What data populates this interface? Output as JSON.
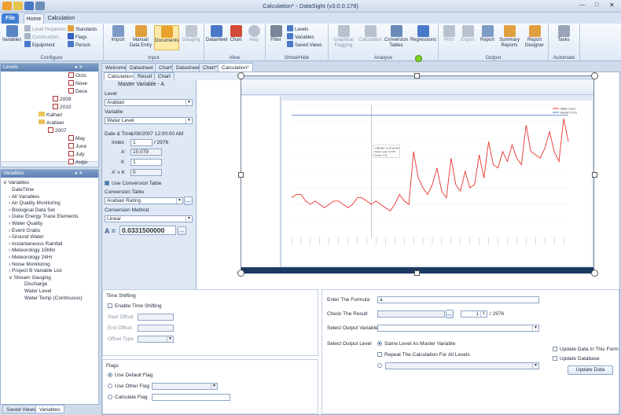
{
  "window": {
    "title": "Calculation* - DataSight (v3.0.0.178)"
  },
  "tabs": {
    "file": "File",
    "home": "Home",
    "calculation": "Calculation"
  },
  "ribbon": {
    "configure": {
      "label": "Configure",
      "variables": "Variables",
      "level_properties": "Level Properties",
      "construction": "Construction",
      "equipment": "Equipment",
      "standards": "Standards",
      "flags": "Flags",
      "person": "Person"
    },
    "input": {
      "label": "Input",
      "import": "Import",
      "manual": "Manual Data Entry",
      "documents": "Documents",
      "gauging": "Gauging"
    },
    "view": {
      "label": "View",
      "datasheet": "Datasheet",
      "chart": "Chart",
      "map": "Map"
    },
    "showhide": {
      "label": "Show/Hide",
      "filter": "Filter",
      "levels": "Levels",
      "variables": "Variables",
      "saved_views": "Saved Views"
    },
    "analyse": {
      "label": "Analyse",
      "graphical": "Graphical Flagging",
      "calculation": "Calculation",
      "conversion": "Conversion Tables",
      "regressions": "Regressions"
    },
    "output": {
      "label": "Output",
      "print": "Print",
      "export": "Export",
      "report": "Report",
      "summary": "Summary Reports",
      "designer": "Report Designer"
    },
    "automate": {
      "label": "Automate",
      "tasks": "Tasks"
    }
  },
  "levels": {
    "title": "Levels",
    "rows": [
      "Octo",
      "Nove",
      "Dece",
      "2009",
      "2010",
      "Kalhari",
      "Arabian",
      "2007",
      "May",
      "June",
      "July",
      "Augu"
    ]
  },
  "variables": {
    "title": "Variables",
    "root": "Variables",
    "items": [
      "DateTime",
      "All Variables",
      "Air Quality Monitoring",
      "Biological Data Set",
      "Duke Energy Trace Elements",
      "Water Quality",
      "Event Grabs",
      "Ground Water",
      "Instantaneous Rainfall",
      "Meteorology 15Min",
      "Meteorology 24Hr",
      "Noise Monitoring",
      "Project B Variable List",
      "Stream Gauging",
      "Discharge",
      "Water Level",
      "Water Temp (Continuous)"
    ]
  },
  "bottom_tabs": {
    "saved_views": "Saved Views",
    "variables": "Variables"
  },
  "doc_tabs": [
    "Welcome",
    "Datasheet",
    "Chart*",
    "Datasheet",
    "Chart*",
    "Calculation*"
  ],
  "sub_tabs": [
    "Calculation",
    "Result",
    "Chart"
  ],
  "master": {
    "title": "Master Variable - A",
    "level_label": "Level",
    "level_value": "Arabian",
    "variable_label": "Variable",
    "variable_value": "Water Level",
    "datetime_label": "Date & Time",
    "datetime_value": "1/08/2007 12:00:00 AM",
    "index_label": "Index",
    "index_value": "1",
    "index_total": "/ 2976",
    "a_label": "A'",
    "a_value": "10.079",
    "k_label": "K",
    "k_value": "1",
    "axk_label": "A' x K",
    "axk_value": "0",
    "use_conversion": "Use Conversion Table",
    "conv_table_label": "Conversion Table",
    "conv_table_value": "Arabian Rating",
    "conv_method_label": "Conversion Method",
    "conv_method_value": "Linear",
    "result_label": "A =",
    "result_value": "0.0331500000"
  },
  "time_shift": {
    "title": "Time Shifting",
    "enable": "Enable Time Shifting",
    "start": "Start Offset",
    "end": "End Offset",
    "type": "Offset Type"
  },
  "flags": {
    "title": "Flags",
    "default": "Use Default Flag",
    "other": "Use Other Flag",
    "calculate": "Calculate Flag"
  },
  "formula": {
    "enter_label": "Enter The Formula",
    "enter_value": "a",
    "check_label": "Check The Result",
    "check_index": "1",
    "check_total": "/ 2976",
    "output_var_label": "Select Output Variable",
    "output_level_label": "Select Output Level",
    "same_level": "Same Level As Master Variable",
    "repeat": "Repeat The Calculation For All Levels",
    "update_form": "Update Data In This Form",
    "update_db": "Update Database",
    "update_btn": "Update Data"
  },
  "embedded": {
    "title": "Calculation* - DataSight",
    "legend": [
      "Water Level",
      "Result X 0.01"
    ],
    "tooltip": [
      "1/08/2007 12:00:00 AM",
      "Water Level: 10.079",
      "Result: 0.03"
    ]
  },
  "chart_data": {
    "type": "line",
    "ylim": [
      8,
      12
    ],
    "series": [
      {
        "name": "Water Level",
        "color": "#e8332c",
        "values": [
          9.2,
          9.3,
          9.3,
          9.1,
          9.0,
          9.1,
          9.0,
          8.9,
          9.0,
          9.1,
          9.1,
          9.0,
          8.9,
          9.0,
          9.2,
          9.2,
          9.1,
          9.0,
          9.1,
          9.0,
          8.9,
          8.8,
          9.0,
          9.3,
          9.1,
          9.0,
          10.6,
          9.8,
          9.5,
          9.3,
          9.6,
          10.1,
          9.4,
          9.2,
          10.4,
          9.6,
          9.4,
          10.0,
          9.5,
          9.6,
          10.5,
          9.8,
          10.9,
          10.2,
          10.1,
          10.6,
          10.3,
          10.8,
          10.4,
          10.2,
          11.4,
          10.6,
          10.5,
          10.4,
          10.7,
          11.2,
          10.6,
          10.3,
          11.6,
          10.9
        ]
      },
      {
        "name": "Result X 0.01",
        "color": "#4a78c8",
        "values": [
          11.7,
          11.7,
          11.7,
          11.7,
          11.7,
          11.7,
          11.7,
          11.7,
          11.7,
          11.7,
          11.7,
          11.7,
          11.7,
          11.7,
          11.7,
          11.7,
          11.7,
          11.7,
          11.7,
          11.7,
          11.7,
          11.7,
          11.7,
          11.7,
          11.7,
          11.7,
          11.7,
          11.7,
          11.7,
          11.7,
          11.7,
          11.7,
          11.7,
          11.7,
          11.7,
          11.7,
          11.7,
          11.7,
          11.7,
          11.7,
          11.7,
          11.7,
          11.7,
          11.7,
          11.7,
          11.7,
          11.7,
          11.7,
          11.7,
          11.7,
          11.7,
          11.7,
          11.7,
          11.7,
          11.7,
          11.7,
          11.7,
          11.7,
          11.7,
          11.7
        ]
      }
    ]
  }
}
